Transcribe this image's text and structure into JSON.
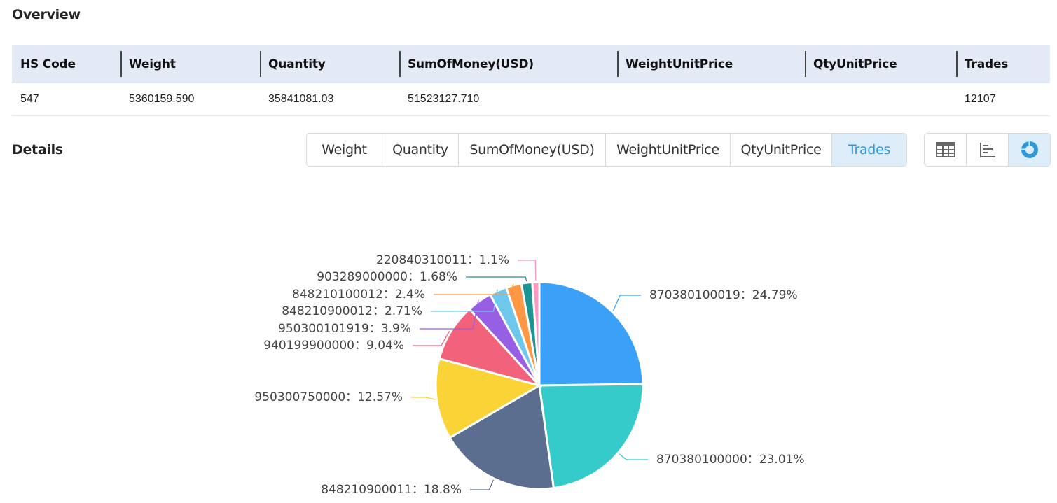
{
  "overview": {
    "title": "Overview",
    "columns": [
      "HS Code",
      "Weight",
      "Quantity",
      "SumOfMoney(USD)",
      "WeightUnitPrice",
      "QtyUnitPrice",
      "Trades"
    ],
    "row": [
      "547",
      "5360159.590",
      "35841081.03",
      "51523127.710",
      "",
      "",
      "12107"
    ]
  },
  "details": {
    "title": "Details",
    "metric_tabs": [
      {
        "label": "Weight",
        "active": false
      },
      {
        "label": "Quantity",
        "active": false
      },
      {
        "label": "SumOfMoney(USD)",
        "active": false
      },
      {
        "label": "WeightUnitPrice",
        "active": false
      },
      {
        "label": "QtyUnitPrice",
        "active": false
      },
      {
        "label": "Trades",
        "active": true
      }
    ],
    "view_tabs": [
      {
        "icon": "table-icon",
        "active": false
      },
      {
        "icon": "bar-chart-icon",
        "active": false
      },
      {
        "icon": "pie-chart-icon",
        "active": true
      }
    ]
  },
  "colors": {
    "accent": "#2f97d6",
    "header_bg": "#e4e9f6"
  },
  "chart_data": {
    "type": "pie",
    "title": "",
    "label_format": "{name}：{value}%",
    "slices": [
      {
        "name": "870380100019",
        "value": 24.79,
        "color": "#3ba0f8"
      },
      {
        "name": "870380100000",
        "value": 23.01,
        "color": "#36cbcb"
      },
      {
        "name": "848210900011",
        "value": 18.8,
        "color": "#5b6e8f"
      },
      {
        "name": "950300750000",
        "value": 12.57,
        "color": "#fad337"
      },
      {
        "name": "940199900000",
        "value": 9.04,
        "color": "#f2637b"
      },
      {
        "name": "950300101919",
        "value": 3.9,
        "color": "#975fe4"
      },
      {
        "name": "848210900012",
        "value": 2.71,
        "color": "#6dc8ec"
      },
      {
        "name": "848210100012",
        "value": 2.4,
        "color": "#ff9845"
      },
      {
        "name": "903289000000",
        "value": 1.68,
        "color": "#1e9493"
      },
      {
        "name": "220840310011",
        "value": 1.1,
        "color": "#ff99c3"
      }
    ]
  }
}
